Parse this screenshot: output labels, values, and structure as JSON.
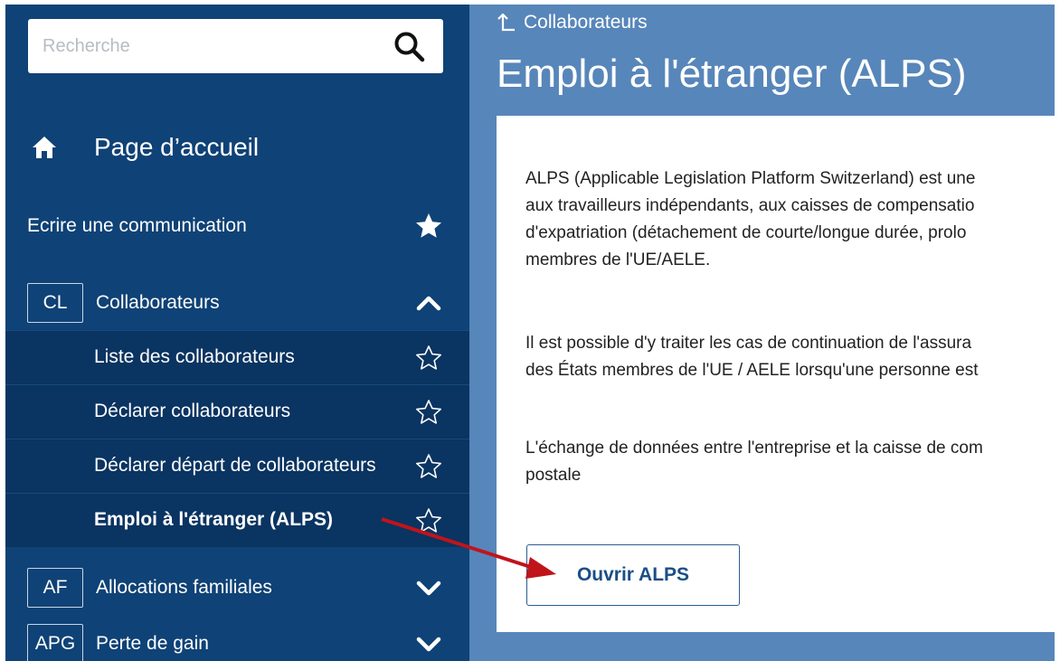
{
  "search": {
    "placeholder": "Recherche"
  },
  "sidebar": {
    "home_label": "Page d’accueil",
    "write_label": "Ecrire une communication",
    "sections": [
      {
        "code": "CL",
        "label": "Collaborateurs",
        "expanded": true
      },
      {
        "code": "AF",
        "label": "Allocations familiales",
        "expanded": false
      },
      {
        "code": "APG",
        "label": "Perte de gain",
        "expanded": false
      }
    ],
    "sub_items": [
      {
        "label": "Liste des collaborateurs"
      },
      {
        "label": "Déclarer collaborateurs"
      },
      {
        "label": "Déclarer départ de collaborateurs"
      },
      {
        "label": "Emploi à l'étranger (ALPS)",
        "active": true
      }
    ]
  },
  "main": {
    "breadcrumb": "Collaborateurs",
    "title": "Emploi à l'étranger (ALPS)",
    "paragraphs": [
      [
        "ALPS (Applicable Legislation Platform Switzerland) est une",
        "aux travailleurs indépendants, aux caisses de compensatio",
        "d'expatriation (détachement de courte/longue durée, prolo",
        "membres de l'UE/AELE."
      ],
      [
        "Il est possible d'y traiter les cas de continuation de l'assura",
        "des États membres de l'UE / AELE lorsqu'une personne est"
      ],
      [
        "L'échange de données entre l'entreprise et la caisse de com",
        "postale"
      ]
    ],
    "open_button": "Ouvrir ALPS"
  },
  "colors": {
    "sidebar_bg": "#0f4276",
    "sidebar_sub_bg": "#0a3461",
    "main_bg": "#5786ba",
    "button_text": "#1a4f86",
    "annotation_arrow": "#c0141b"
  }
}
